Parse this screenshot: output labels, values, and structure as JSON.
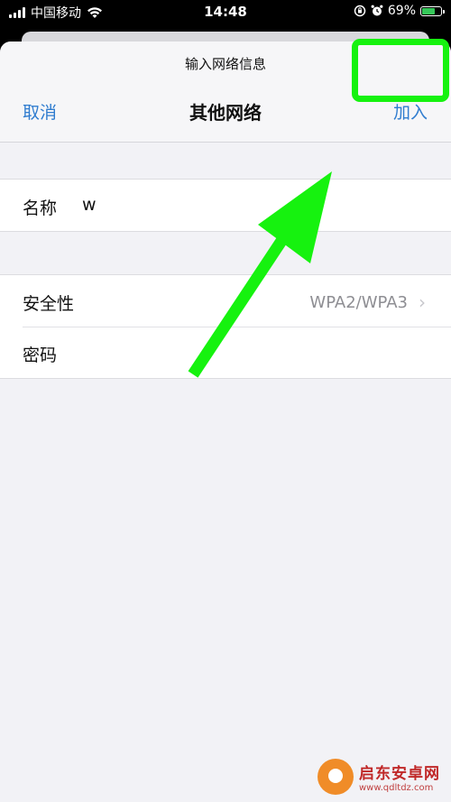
{
  "status_bar": {
    "carrier": "中国移动",
    "time": "14:48",
    "battery_percent": "69%",
    "battery_level": 0.69,
    "icons": [
      "signal-icon",
      "wifi-icon",
      "orientation-lock-icon",
      "alarm-icon",
      "battery-icon"
    ]
  },
  "nav": {
    "prompt": "输入网络信息",
    "cancel_label": "取消",
    "title": "其他网络",
    "join_label": "加入"
  },
  "form": {
    "name_label": "名称",
    "name_value": "w",
    "security_label": "安全性",
    "security_value": "WPA2/WPA3",
    "password_label": "密码"
  },
  "annotation": {
    "color": "#16f20f"
  },
  "watermark": {
    "name": "启东安卓网",
    "url": "www.qdltdz.com"
  },
  "colors": {
    "accent": "#2f7ccf",
    "battery_fill": "#35c759"
  }
}
